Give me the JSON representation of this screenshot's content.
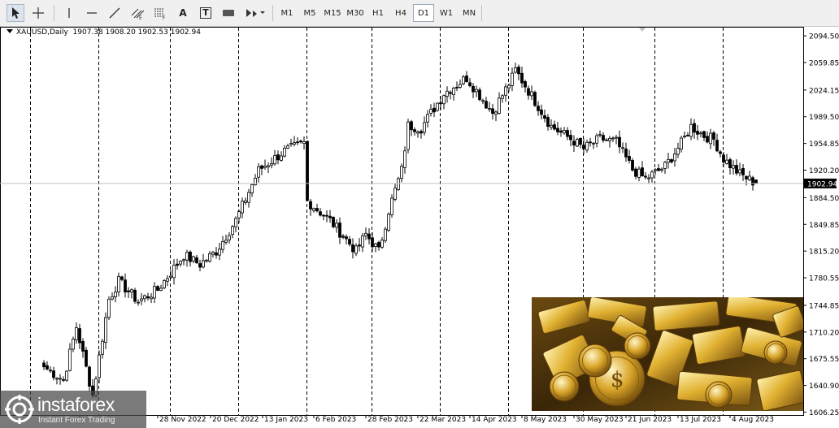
{
  "toolbar": {
    "tools": [
      {
        "name": "cursor-icon"
      },
      {
        "name": "crosshair-icon"
      },
      {
        "name": "vertical-line-icon"
      },
      {
        "name": "horizontal-line-icon"
      },
      {
        "name": "trendline-icon"
      },
      {
        "name": "equidistant-channel-icon"
      },
      {
        "name": "fibonacci-icon"
      },
      {
        "name": "text-icon",
        "label": "A"
      },
      {
        "name": "text-label-icon",
        "label": "T"
      },
      {
        "name": "shapes-icon"
      },
      {
        "name": "arrows-icon"
      }
    ],
    "timeframes": [
      "M1",
      "M5",
      "M15",
      "M30",
      "H1",
      "H4",
      "D1",
      "W1",
      "MN"
    ],
    "active_timeframe": "D1"
  },
  "symbol": {
    "name": "XAUUSD,Daily",
    "ohlc": "1907.38 1908.20 1902.53 1902.94"
  },
  "price_axis": {
    "labels": [
      "2094.50",
      "2059.85",
      "2024.15",
      "1989.50",
      "1954.85",
      "1920.20",
      "1884.50",
      "1849.85",
      "1815.20",
      "1780.55",
      "1744.85",
      "1710.20",
      "1675.55",
      "1640.90",
      "1606.25"
    ],
    "current_price": "1902.94"
  },
  "date_axis": {
    "labels": [
      "",
      "",
      "28 Nov 2022",
      "20 Dec 2022",
      "13 Jan 2023",
      "6 Feb 2023",
      "28 Feb 2023",
      "22 Mar 2023",
      "14 Apr 2023",
      "8 May 2023",
      "30 May 2023",
      "21 Jun 2023",
      "13 Jul 2023",
      "4 Aug 2023"
    ]
  },
  "watermark": {
    "brand": "instaforex",
    "tagline": "Instant Forex Trading"
  },
  "colors": {
    "background": "#ffffff",
    "candle": "#000000",
    "bid_line": "#c0c0c0",
    "price_tag_bg": "#000000",
    "price_tag_fg": "#ffffff"
  },
  "chart_data": {
    "type": "candlestick",
    "symbol": "XAUUSD",
    "timeframe": "Daily",
    "ylim": [
      1602.5,
      2106.2
    ],
    "grid": "vertical dashed separators",
    "close_anchors": [
      {
        "date": "2022-10-13",
        "close": 1665
      },
      {
        "date": "2022-10-21",
        "close": 1648
      },
      {
        "date": "2022-10-27",
        "close": 1717
      },
      {
        "date": "2022-11-03",
        "close": 1628
      },
      {
        "date": "2022-11-10",
        "close": 1753
      },
      {
        "date": "2022-11-15",
        "close": 1776
      },
      {
        "date": "2022-11-23",
        "close": 1750
      },
      {
        "date": "2022-12-01",
        "close": 1765
      },
      {
        "date": "2022-12-13",
        "close": 1810
      },
      {
        "date": "2022-12-20",
        "close": 1798
      },
      {
        "date": "2022-12-27",
        "close": 1815
      },
      {
        "date": "2023-01-04",
        "close": 1855
      },
      {
        "date": "2023-01-13",
        "close": 1920
      },
      {
        "date": "2023-01-25",
        "close": 1945
      },
      {
        "date": "2023-02-02",
        "close": 1955
      },
      {
        "date": "2023-02-03",
        "close": 1880
      },
      {
        "date": "2023-02-14",
        "close": 1855
      },
      {
        "date": "2023-02-24",
        "close": 1815
      },
      {
        "date": "2023-03-01",
        "close": 1837
      },
      {
        "date": "2023-03-07",
        "close": 1815
      },
      {
        "date": "2023-03-10",
        "close": 1868
      },
      {
        "date": "2023-03-16",
        "close": 1920
      },
      {
        "date": "2023-03-20",
        "close": 1978
      },
      {
        "date": "2023-03-24",
        "close": 1975
      },
      {
        "date": "2023-04-04",
        "close": 2020
      },
      {
        "date": "2023-04-13",
        "close": 2040
      },
      {
        "date": "2023-04-25",
        "close": 1995
      },
      {
        "date": "2023-05-03",
        "close": 2040
      },
      {
        "date": "2023-05-04",
        "close": 2050
      },
      {
        "date": "2023-05-12",
        "close": 2010
      },
      {
        "date": "2023-05-19",
        "close": 1977
      },
      {
        "date": "2023-05-30",
        "close": 1958
      },
      {
        "date": "2023-06-02",
        "close": 1948
      },
      {
        "date": "2023-06-09",
        "close": 1961
      },
      {
        "date": "2023-06-16",
        "close": 1957
      },
      {
        "date": "2023-06-23",
        "close": 1921
      },
      {
        "date": "2023-06-29",
        "close": 1909
      },
      {
        "date": "2023-07-07",
        "close": 1925
      },
      {
        "date": "2023-07-14",
        "close": 1955
      },
      {
        "date": "2023-07-19",
        "close": 1977
      },
      {
        "date": "2023-07-25",
        "close": 1965
      },
      {
        "date": "2023-07-28",
        "close": 1960
      },
      {
        "date": "2023-08-02",
        "close": 1935
      },
      {
        "date": "2023-08-09",
        "close": 1915
      },
      {
        "date": "2023-08-16",
        "close": 1902.94
      }
    ],
    "last_bar": {
      "open": 1907.38,
      "high": 1908.2,
      "low": 1902.53,
      "close": 1902.94
    }
  }
}
